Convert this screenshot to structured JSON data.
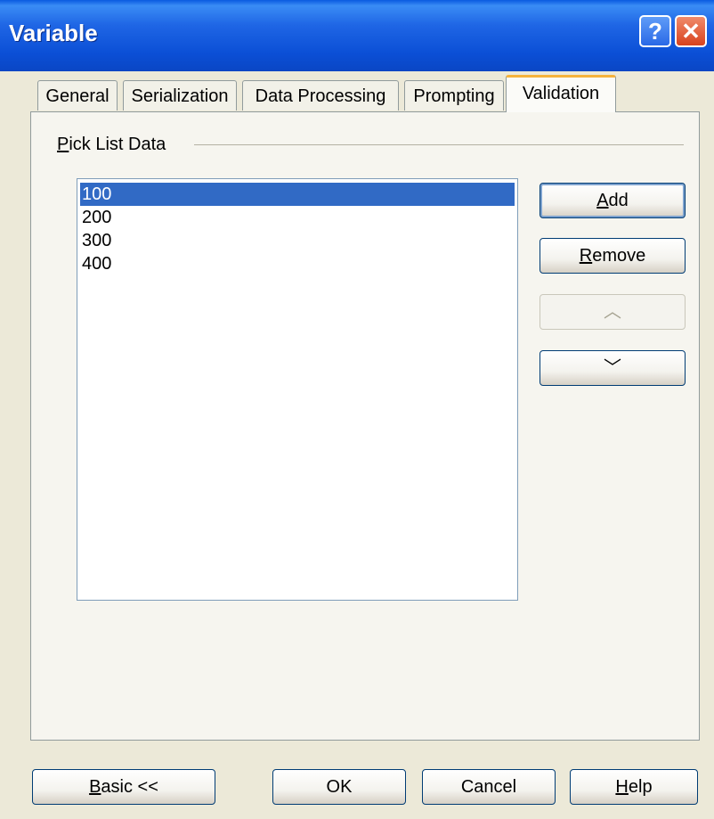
{
  "window": {
    "title": "Variable"
  },
  "titlebar": {
    "help_glyph": "?",
    "close_glyph": "✕"
  },
  "tabs": [
    {
      "label": "General"
    },
    {
      "label": "Serialization"
    },
    {
      "label": "Data Processing"
    },
    {
      "label": "Prompting"
    },
    {
      "label": "Validation",
      "active": true
    }
  ],
  "group": {
    "label": "Pick List Data"
  },
  "pick_list": {
    "items": [
      "100",
      "200",
      "300",
      "400"
    ],
    "selected": "100"
  },
  "side_buttons": {
    "add": "Add",
    "remove": "Remove",
    "up_glyph": "︿",
    "down_glyph": "﹀"
  },
  "footer": {
    "basic": "Basic <<",
    "ok": "OK",
    "cancel": "Cancel",
    "help": "Help"
  },
  "icons": {
    "help": "help-icon",
    "close": "close-icon",
    "up": "chevron-up-icon",
    "down": "chevron-down-icon"
  }
}
